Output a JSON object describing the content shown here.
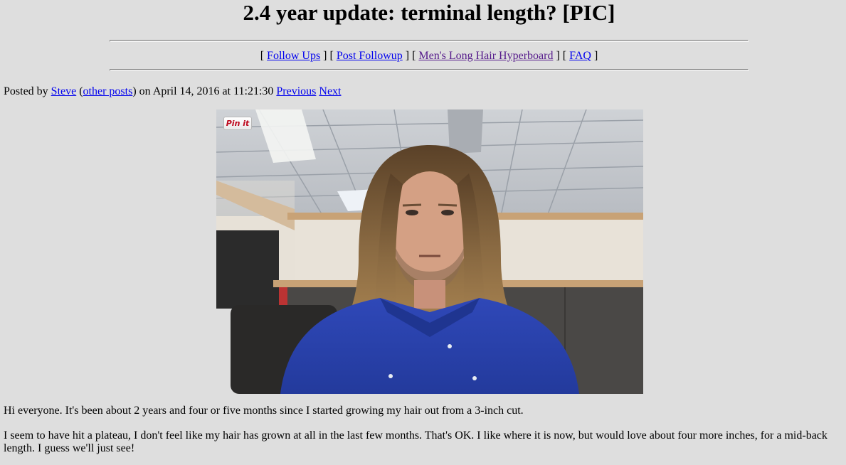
{
  "post": {
    "title": "2.4 year update: terminal length? [PIC]"
  },
  "nav": {
    "open1": "[ ",
    "follow_ups": "Follow Ups",
    "sep1": " ] [ ",
    "post_followup": "Post Followup",
    "sep2": " ] [ ",
    "hyperboard": "Men's Long Hair Hyperboard",
    "sep3": " ] [ ",
    "faq": "FAQ",
    "close": " ]"
  },
  "meta": {
    "posted_by": "Posted by ",
    "author": "Steve",
    "paren_open": " (",
    "other_posts": "other posts",
    "date_text": ") on April 14, 2016 at 11:21:30 ",
    "previous": "Previous",
    "next": "Next"
  },
  "image": {
    "pin_label": "Pin it"
  },
  "body": {
    "paragraph1": "Hi everyone. It's been about 2 years and four or five months since I started growing my hair out from a 3-inch cut.",
    "paragraph2": "I seem to have hit a plateau, I don't feel like my hair has grown at all in the last few months. That's OK. I like where it is now, but would love about four more inches, for a mid-back length. I guess we'll just see!"
  },
  "colors": {
    "background": "#dedede",
    "link": "#0000ee",
    "visited_link": "#551a8b",
    "pinterest_red": "#bd081c"
  }
}
